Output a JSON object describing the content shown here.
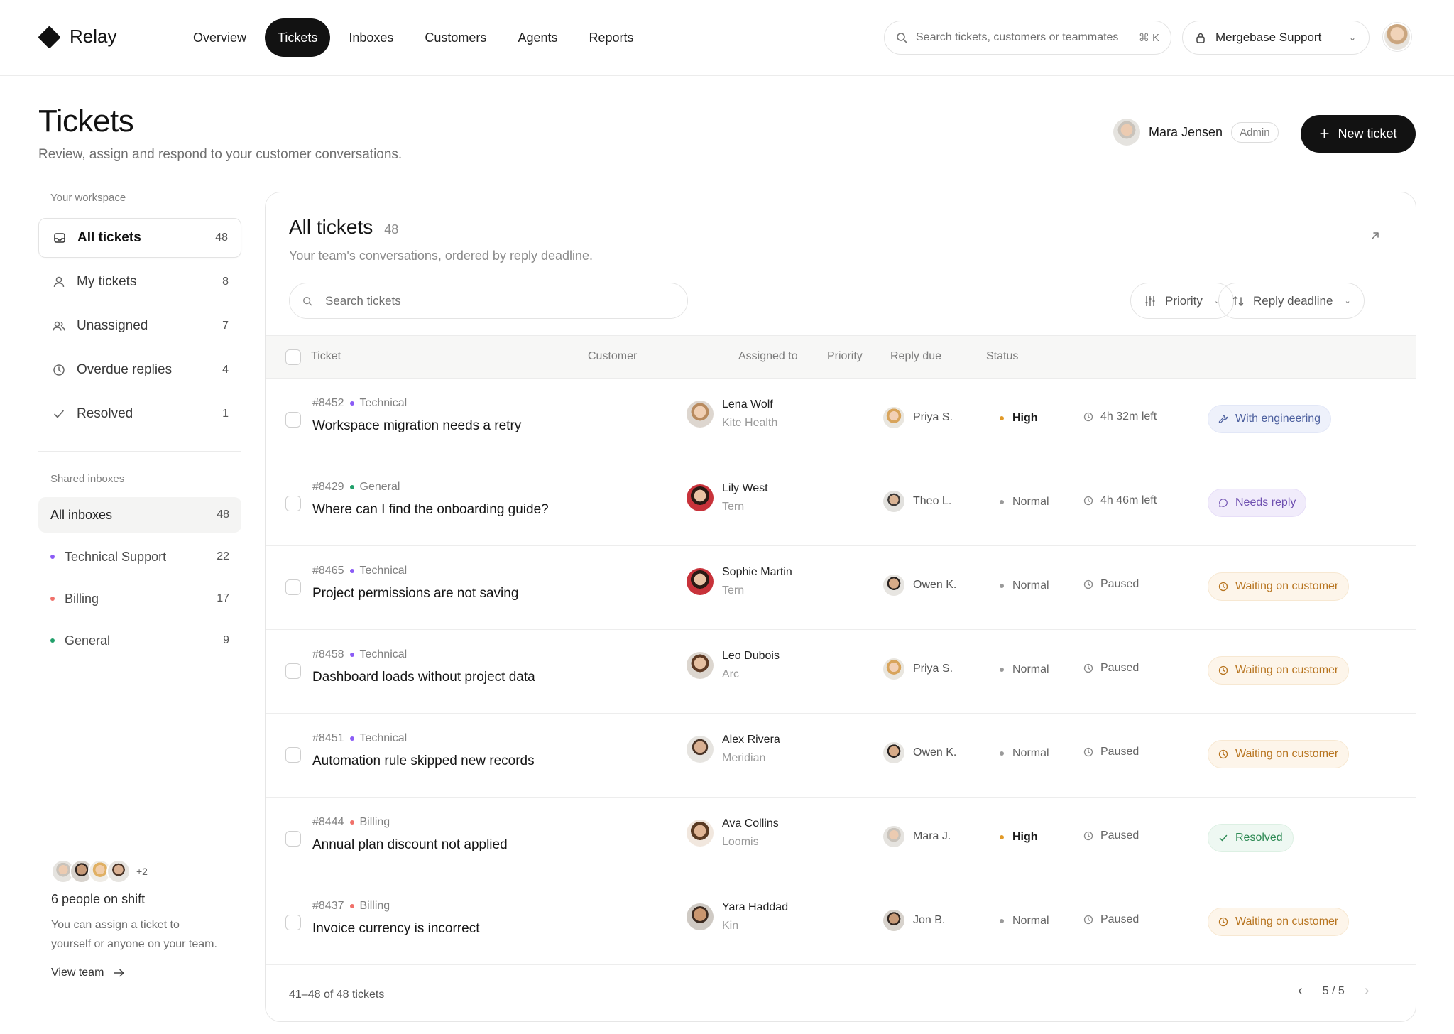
{
  "brand": {
    "name": "Relay"
  },
  "nav": {
    "items": [
      {
        "label": "Overview",
        "active": false
      },
      {
        "label": "Tickets",
        "active": true
      },
      {
        "label": "Inboxes",
        "active": false
      },
      {
        "label": "Customers",
        "active": false
      },
      {
        "label": "Agents",
        "active": false
      },
      {
        "label": "Reports",
        "active": false
      }
    ]
  },
  "global_search": {
    "placeholder": "Search tickets, customers or teammates",
    "shortcut": "⌘ K"
  },
  "workspace_switcher": {
    "label": "Mergebase Support",
    "icon": "lock-icon"
  },
  "page": {
    "title": "Tickets",
    "subtitle": "Review, assign and respond to your customer conversations."
  },
  "current_user": {
    "name": "Mara Jensen",
    "role": "Admin"
  },
  "new_ticket_button": {
    "label": "New ticket"
  },
  "sidebar": {
    "workspace_heading": "Your workspace",
    "views": [
      {
        "label": "All tickets",
        "count": "48",
        "icon": "inbox-icon",
        "active": true
      },
      {
        "label": "My tickets",
        "count": "8",
        "icon": "user-icon",
        "active": false
      },
      {
        "label": "Unassigned",
        "count": "7",
        "icon": "users-icon",
        "active": false
      },
      {
        "label": "Overdue replies",
        "count": "4",
        "icon": "clock-icon",
        "active": false
      },
      {
        "label": "Resolved",
        "count": "1",
        "icon": "check-icon",
        "active": false
      }
    ],
    "inboxes_heading": "Shared inboxes",
    "inboxes": [
      {
        "label": "All inboxes",
        "count": "48",
        "active": true,
        "color": ""
      },
      {
        "label": "Technical Support",
        "count": "22",
        "active": false,
        "color": "#8b5cf6"
      },
      {
        "label": "Billing",
        "count": "17",
        "active": false,
        "color": "#f0716a"
      },
      {
        "label": "General",
        "count": "9",
        "active": false,
        "color": "#22a06b"
      }
    ],
    "shift": {
      "more": "+2",
      "title": "6 people on shift",
      "description": "You can assign a ticket to yourself or anyone on your team.",
      "link": "View team"
    }
  },
  "table_card": {
    "title": "All tickets",
    "count": "48",
    "subtitle": "Your team's conversations, ordered by reply deadline.",
    "search_placeholder": "Search tickets",
    "filter_priority": "Priority",
    "sort_label": "Reply deadline",
    "columns": [
      "Ticket",
      "Customer",
      "Assigned to",
      "Priority",
      "Reply due",
      "Status"
    ],
    "rows": [
      {
        "id": "#8452",
        "category": "Technical",
        "category_color": "#8b5cf6",
        "title": "Workspace migration needs a retry",
        "customer": "Lena Wolf",
        "company": "Kite Health",
        "assignee": "Priya S.",
        "priority": "High",
        "reply_due": "4h 32m left",
        "status": "With engineering",
        "status_kind": "eng"
      },
      {
        "id": "#8429",
        "category": "General",
        "category_color": "#22a06b",
        "title": "Where can I find the onboarding guide?",
        "customer": "Lily West",
        "company": "Tern",
        "assignee": "Theo L.",
        "priority": "Normal",
        "reply_due": "4h 46m left",
        "status": "Needs reply",
        "status_kind": "reply"
      },
      {
        "id": "#8465",
        "category": "Technical",
        "category_color": "#8b5cf6",
        "title": "Project permissions are not saving",
        "customer": "Sophie Martin",
        "company": "Tern",
        "assignee": "Owen K.",
        "priority": "Normal",
        "reply_due": "Paused",
        "status": "Waiting on customer",
        "status_kind": "wait"
      },
      {
        "id": "#8458",
        "category": "Technical",
        "category_color": "#8b5cf6",
        "title": "Dashboard loads without project data",
        "customer": "Leo Dubois",
        "company": "Arc",
        "assignee": "Priya S.",
        "priority": "Normal",
        "reply_due": "Paused",
        "status": "Waiting on customer",
        "status_kind": "wait"
      },
      {
        "id": "#8451",
        "category": "Technical",
        "category_color": "#8b5cf6",
        "title": "Automation rule skipped new records",
        "customer": "Alex Rivera",
        "company": "Meridian",
        "assignee": "Owen K.",
        "priority": "Normal",
        "reply_due": "Paused",
        "status": "Waiting on customer",
        "status_kind": "wait"
      },
      {
        "id": "#8444",
        "category": "Billing",
        "category_color": "#f0716a",
        "title": "Annual plan discount not applied",
        "customer": "Ava Collins",
        "company": "Loomis",
        "assignee": "Mara J.",
        "priority": "High",
        "reply_due": "Paused",
        "status": "Resolved",
        "status_kind": "res"
      },
      {
        "id": "#8437",
        "category": "Billing",
        "category_color": "#f0716a",
        "title": "Invoice currency is incorrect",
        "customer": "Yara Haddad",
        "company": "Kin",
        "assignee": "Jon B.",
        "priority": "Normal",
        "reply_due": "Paused",
        "status": "Waiting on customer",
        "status_kind": "wait"
      }
    ],
    "footer_range": "41–48 of 48 tickets",
    "pagination": "5 / 5"
  }
}
